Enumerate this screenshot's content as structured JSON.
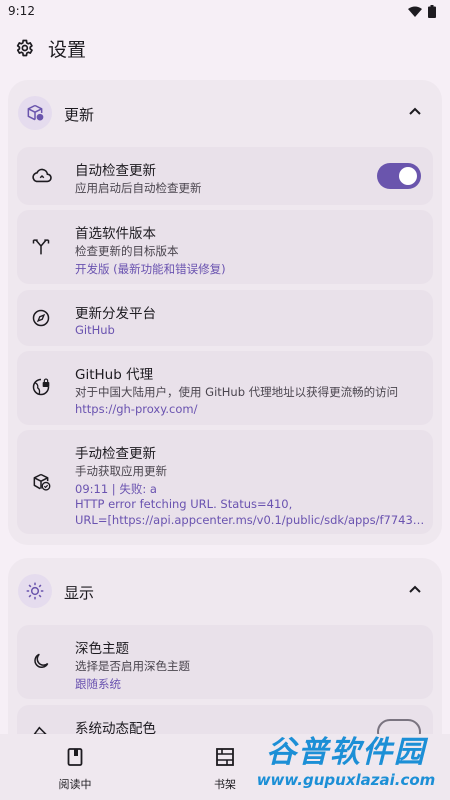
{
  "status_bar": {
    "time": "9:12"
  },
  "app_bar": {
    "title": "设置"
  },
  "sections": {
    "update": {
      "title": "更新",
      "auto_check": {
        "title": "自动检查更新",
        "subtitle": "应用启动后自动检查更新",
        "enabled": true
      },
      "preferred_version": {
        "title": "首选软件版本",
        "subtitle": "检查更新的目标版本",
        "value": "开发版 (最新功能和错误修复)"
      },
      "platform": {
        "title": "更新分发平台",
        "value": "GitHub"
      },
      "proxy": {
        "title": "GitHub 代理",
        "subtitle": "对于中国大陆用户，使用 GitHub 代理地址以获得更流畅的访问",
        "value": "https://gh-proxy.com/"
      },
      "manual_check": {
        "title": "手动检查更新",
        "subtitle": "手动获取应用更新",
        "line1": "09:11 | 失败: a",
        "line2": "HTTP error fetching URL. Status=410,",
        "line3": "URL=[https://api.appcenter.ms/v0.1/public/sdk/apps/f77438…"
      }
    },
    "display": {
      "title": "显示",
      "dark_theme": {
        "title": "深色主题",
        "subtitle": "选择是否启用深色主题",
        "value": "跟随系统"
      },
      "dynamic_color": {
        "title": "系统动态配色",
        "enabled": false
      }
    }
  },
  "bottom_nav": {
    "items": [
      {
        "label": "阅读中"
      },
      {
        "label": "书架"
      }
    ]
  },
  "watermark": {
    "main": "谷普软件园",
    "sub": "www.gupuxlazai.com"
  },
  "colors": {
    "accent": "#6a55ad",
    "value_text": "#6a53b0",
    "background": "#f6eff6",
    "card": "#e9e1ea"
  }
}
